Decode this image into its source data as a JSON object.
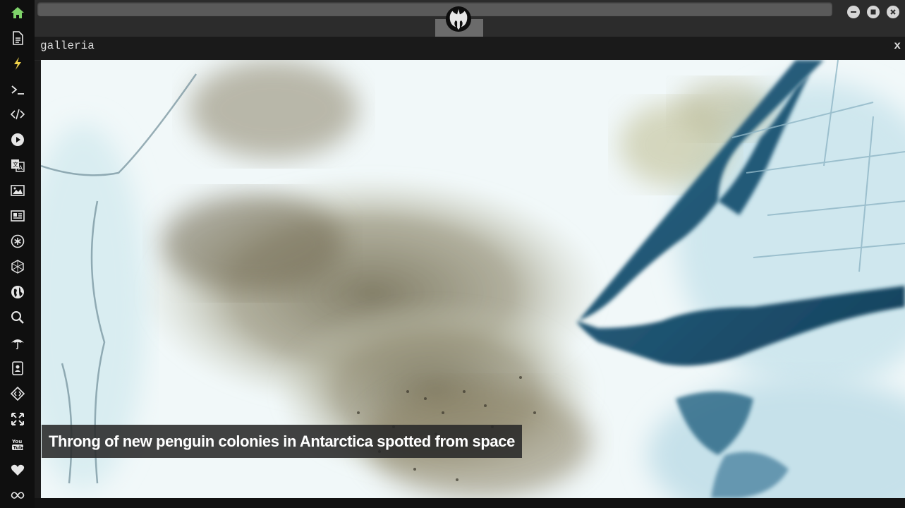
{
  "sidebar": {
    "items": [
      {
        "name": "home-icon",
        "color": "#7fd36a"
      },
      {
        "name": "document-icon",
        "color": "#e6e6e6"
      },
      {
        "name": "lightning-icon",
        "color": "#f0d24a"
      },
      {
        "name": "terminal-icon",
        "color": "#e6e6e6"
      },
      {
        "name": "code-icon",
        "color": "#e6e6e6"
      },
      {
        "name": "play-icon",
        "color": "#e6e6e6"
      },
      {
        "name": "translate-icon",
        "color": "#e6e6e6"
      },
      {
        "name": "image-icon",
        "color": "#e6e6e6"
      },
      {
        "name": "newspaper-icon",
        "color": "#e6e6e6"
      },
      {
        "name": "asterisk-icon",
        "color": "#e6e6e6"
      },
      {
        "name": "hexagon-icon",
        "color": "#e6e6e6"
      },
      {
        "name": "globe-icon",
        "color": "#e6e6e6"
      },
      {
        "name": "search-icon",
        "color": "#e6e6e6"
      },
      {
        "name": "umbrella-icon",
        "color": "#e6e6e6"
      },
      {
        "name": "contacts-icon",
        "color": "#e6e6e6"
      },
      {
        "name": "diamond-code-icon",
        "color": "#e6e6e6"
      },
      {
        "name": "expand-icon",
        "color": "#e6e6e6"
      },
      {
        "name": "youtube-icon",
        "color": "#e6e6e6"
      },
      {
        "name": "heart-icon",
        "color": "#e6e6e6"
      },
      {
        "name": "infinity-icon",
        "color": "#e6e6e6"
      }
    ]
  },
  "titlebar": {
    "logo": "rebel-alliance-icon",
    "buttons": [
      "minimize-icon",
      "maximize-icon",
      "close-icon"
    ]
  },
  "panel": {
    "title": "galleria",
    "close_label": "x"
  },
  "gallery": {
    "caption": "Throng of new penguin colonies in Antarctica spotted from space"
  },
  "colors": {
    "accent_home": "#7fd36a",
    "accent_bolt": "#f0d24a",
    "panel_bg": "#1a1a1a",
    "caption_bg": "#282828"
  }
}
